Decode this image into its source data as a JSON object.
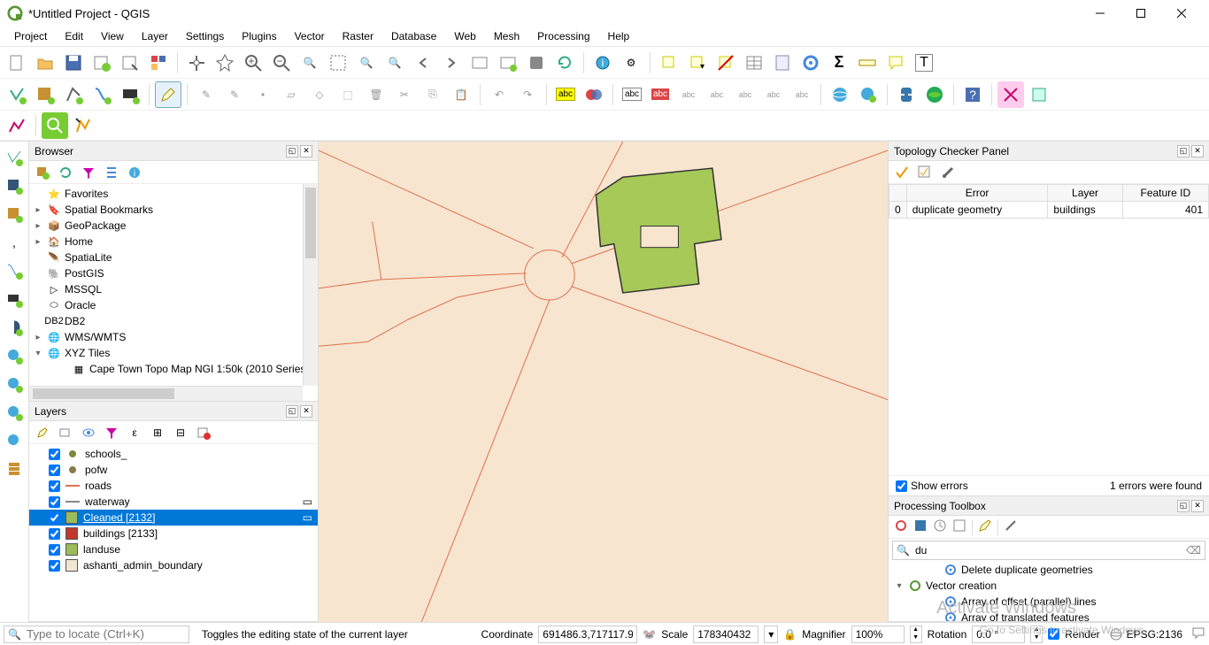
{
  "window": {
    "title": "*Untitled Project - QGIS"
  },
  "menu": {
    "items": [
      "Project",
      "Edit",
      "View",
      "Layer",
      "Settings",
      "Plugins",
      "Vector",
      "Raster",
      "Database",
      "Web",
      "Mesh",
      "Processing",
      "Help"
    ]
  },
  "browser": {
    "title": "Browser",
    "nodes": [
      {
        "label": "Favorites",
        "icon": "star",
        "exp": ""
      },
      {
        "label": "Spatial Bookmarks",
        "icon": "bookmark",
        "exp": "▸"
      },
      {
        "label": "GeoPackage",
        "icon": "geopackage",
        "exp": "▸"
      },
      {
        "label": "Home",
        "icon": "home",
        "exp": "▸"
      },
      {
        "label": "SpatiaLite",
        "icon": "spatialite",
        "exp": ""
      },
      {
        "label": "PostGIS",
        "icon": "postgis",
        "exp": ""
      },
      {
        "label": "MSSQL",
        "icon": "mssql",
        "exp": ""
      },
      {
        "label": "Oracle",
        "icon": "oracle",
        "exp": ""
      },
      {
        "label": "DB2",
        "icon": "db2",
        "exp": ""
      },
      {
        "label": "WMS/WMTS",
        "icon": "wms",
        "exp": "▸"
      },
      {
        "label": "XYZ Tiles",
        "icon": "xyz",
        "exp": "▾"
      },
      {
        "label": "Cape Town Topo Map NGI 1:50k (2010 Series",
        "icon": "xyzlayer",
        "exp": "",
        "indent": 1
      }
    ]
  },
  "layers": {
    "title": "Layers",
    "rows": [
      {
        "label": "schools_",
        "swatch": "point",
        "color": "#7a8a3a"
      },
      {
        "label": "pofw",
        "swatch": "point",
        "color": "#8c7a4a"
      },
      {
        "label": "roads",
        "swatch": "line",
        "color": "#e07050"
      },
      {
        "label": "waterway",
        "swatch": "line",
        "color": "#888",
        "editicon": true
      },
      {
        "label": "Cleaned [2132]",
        "swatch": "poly",
        "color": "#9cbb5a",
        "selected": true,
        "underline": true,
        "editicon": true
      },
      {
        "label": "buildings [2133]",
        "swatch": "poly",
        "color": "#c0392b"
      },
      {
        "label": "landuse",
        "swatch": "poly",
        "color": "#9cbb5a"
      },
      {
        "label": "ashanti_admin_boundary",
        "swatch": "poly",
        "color": "#f0e6d2"
      }
    ]
  },
  "topology": {
    "title": "Topology Checker Panel",
    "cols": [
      "Error",
      "Layer",
      "Feature ID"
    ],
    "row": {
      "idx": "0",
      "error": "duplicate geometry",
      "layer": "buildings",
      "fid": "401"
    },
    "showerrors": "Show errors",
    "found": "1 errors were found"
  },
  "processing": {
    "title": "Processing Toolbox",
    "search": "du",
    "nodes": [
      {
        "label": "Delete duplicate geometries",
        "icon": "gear",
        "indent": 2
      },
      {
        "label": "Vector creation",
        "icon": "qgis",
        "exp": "▾",
        "indent": 0
      },
      {
        "label": "Array of offset (parallel) lines",
        "icon": "gear",
        "indent": 2
      },
      {
        "label": "Array of translated features",
        "icon": "gear",
        "indent": 2
      }
    ]
  },
  "status": {
    "locator_ph": "Type to locate (Ctrl+K)",
    "hint": "Toggles the editing state of the current layer",
    "coord_lbl": "Coordinate",
    "coord": "691486.3,717117.9",
    "scale_lbl": "Scale",
    "scale": "178340432",
    "mag_lbl": "Magnifier",
    "mag": "100%",
    "rot_lbl": "Rotation",
    "rot": "0.0 °",
    "render": "Render",
    "crs": "EPSG:2136"
  },
  "watermark": {
    "l1": "Activate Windows",
    "l2": "Go to Settings to activate Windows."
  }
}
